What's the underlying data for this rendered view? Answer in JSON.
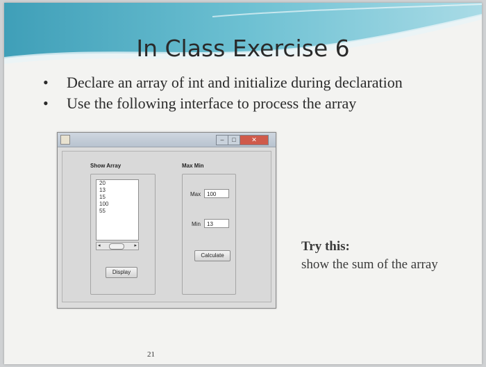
{
  "slide": {
    "title": "In Class Exercise 6",
    "bullets": [
      "Declare an array of int and initialize during declaration",
      "Use the following interface to process the array"
    ],
    "try_title": "Try this:",
    "try_body": "show the sum of the array",
    "page_number": "21"
  },
  "window": {
    "titlebar_buttons": {
      "minimize": "–",
      "maximize": "□",
      "close": "✕"
    },
    "show_array": {
      "label": "Show Array",
      "list_items": [
        "20",
        "13",
        "15",
        "100",
        "55"
      ],
      "display_button": "Display",
      "scroll_left": "◂",
      "scroll_right": "▸"
    },
    "max_min": {
      "label": "Max Min",
      "max_label": "Max",
      "max_value": "100",
      "min_label": "Min",
      "min_value": "13",
      "calculate_button": "Calculate"
    }
  },
  "colors": {
    "banner_teal": "#5aaec3",
    "close_button": "#cf5a4b",
    "slide_background": "#f3f3f1"
  }
}
